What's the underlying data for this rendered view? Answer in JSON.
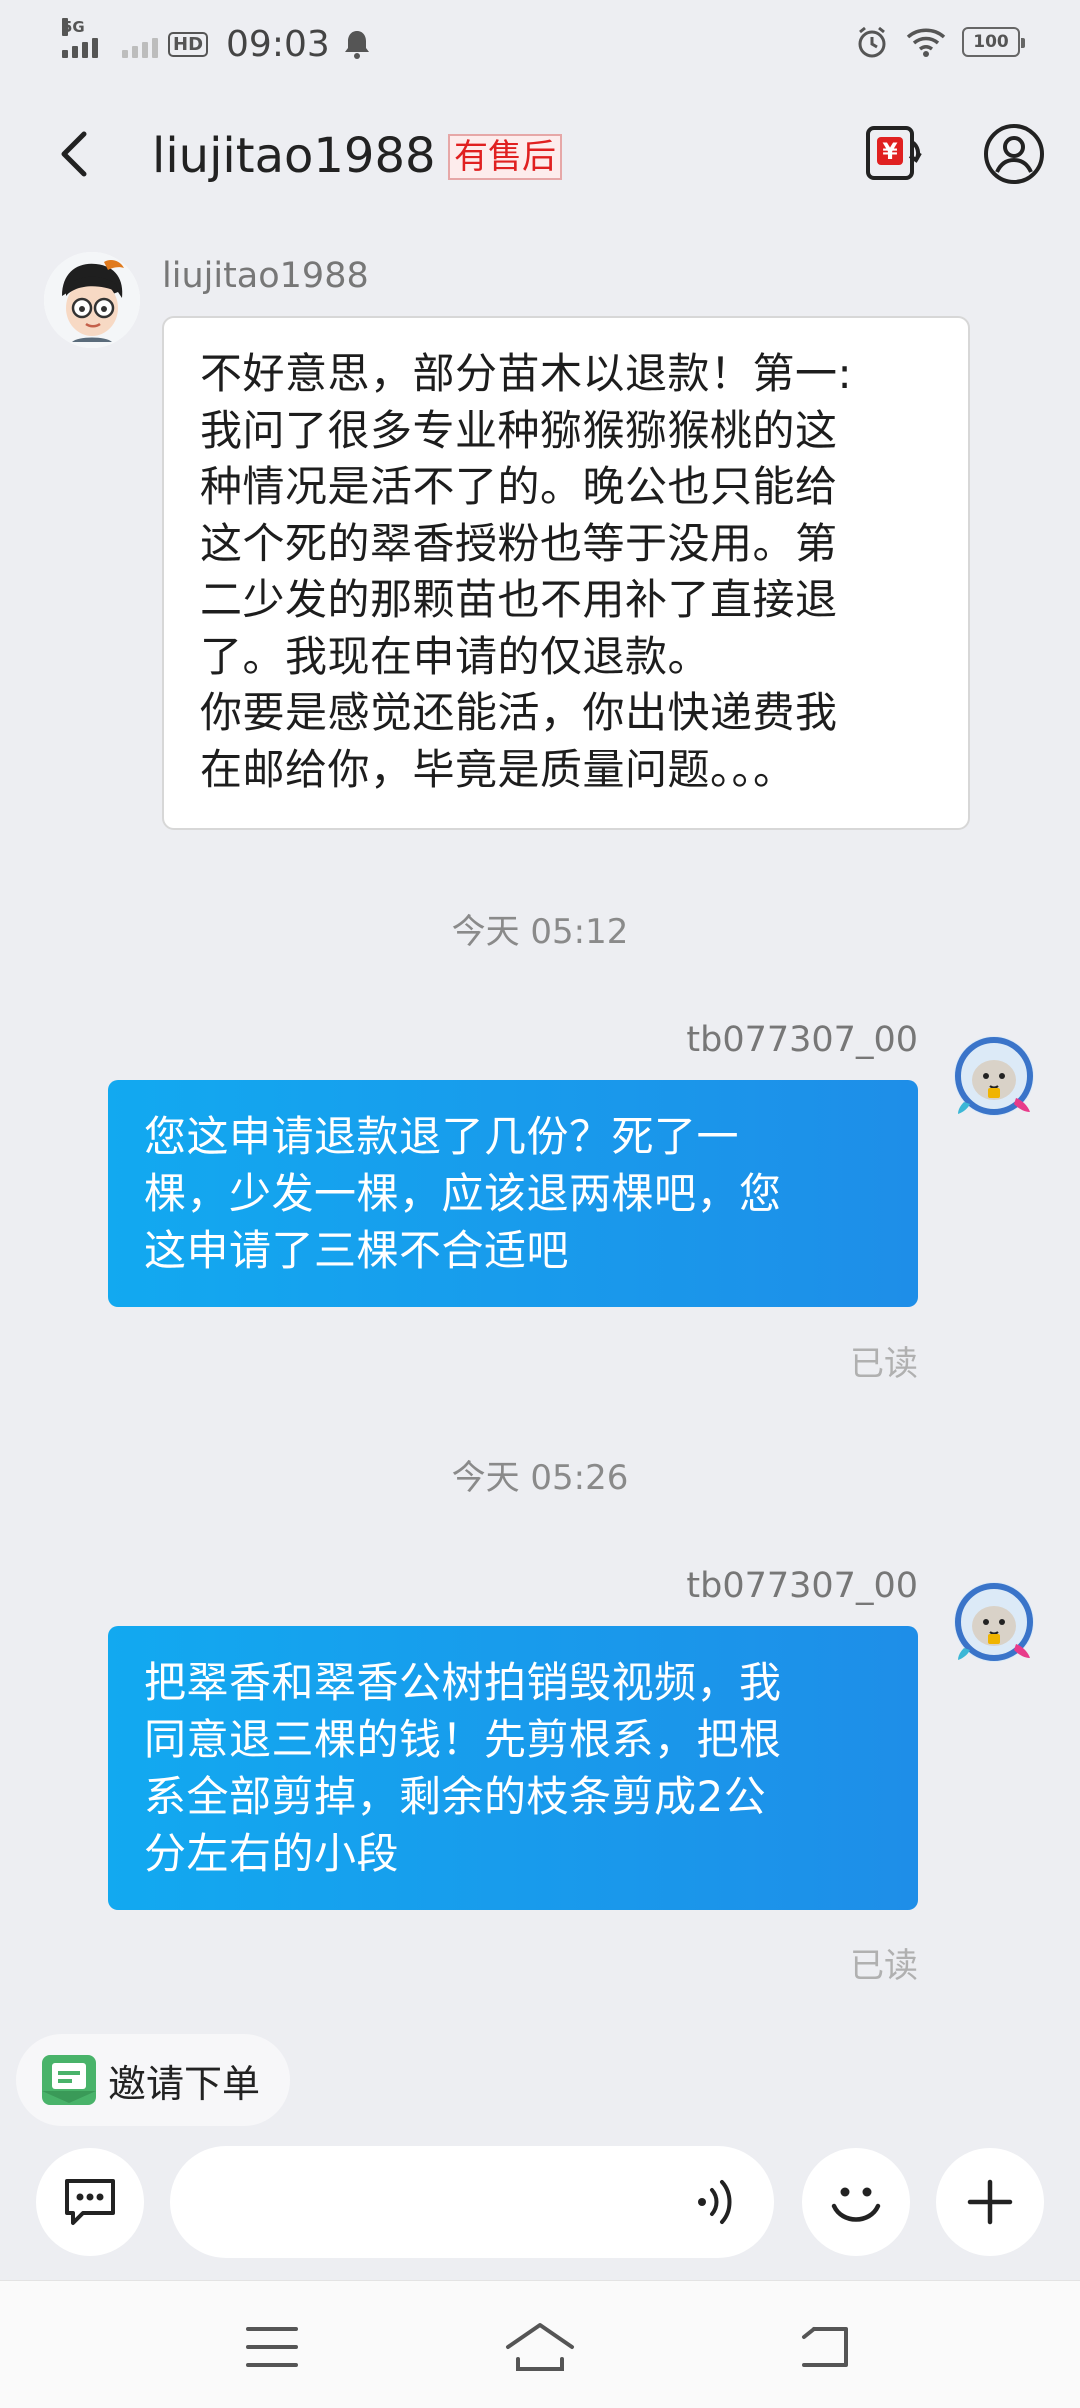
{
  "status_bar": {
    "network": "5G",
    "hd": "HD",
    "time": "09:03",
    "battery": "100"
  },
  "header": {
    "title": "liujitao1988",
    "badge": "有售后"
  },
  "messages": [
    {
      "direction": "incoming",
      "sender": "liujitao1988",
      "lines": [
        "不好意思，部分苗木以退款！第一:",
        "我问了很多专业种猕猴猕猴桃的这",
        "种情况是活不了的。晚公也只能给",
        "这个死的翠香授粉也等于没用。第",
        "二少发的那颗苗也不用补了直接退",
        "了。我现在申请的仅退款。",
        "你要是感觉还能活，你出快递费我",
        "在邮给你，毕竟是质量问题。。。"
      ]
    },
    {
      "timestamp": "今天  05:12",
      "direction": "outgoing",
      "sender": "tb077307_00",
      "lines": [
        "您这申请退款退了几份？死了一",
        "棵，少发一棵，应该退两棵吧，您",
        "这申请了三棵不合适吧"
      ],
      "status": "已读"
    },
    {
      "timestamp": "今天  05:26",
      "direction": "outgoing",
      "sender": "tb077307_00",
      "lines": [
        "把翠香和翠香公树拍销毁视频，我",
        "同意退三棵的钱！先剪根系，把根",
        "系全部剪掉，剩余的枝条剪成2公",
        "分左右的小段"
      ],
      "status": "已读"
    }
  ],
  "invite": {
    "label": "邀请下单"
  },
  "input": {
    "value": "",
    "placeholder": ""
  },
  "colors": {
    "background": "#edeef2",
    "outgoing_bubble": "#1a9bec",
    "badge_red": "#e02020"
  }
}
